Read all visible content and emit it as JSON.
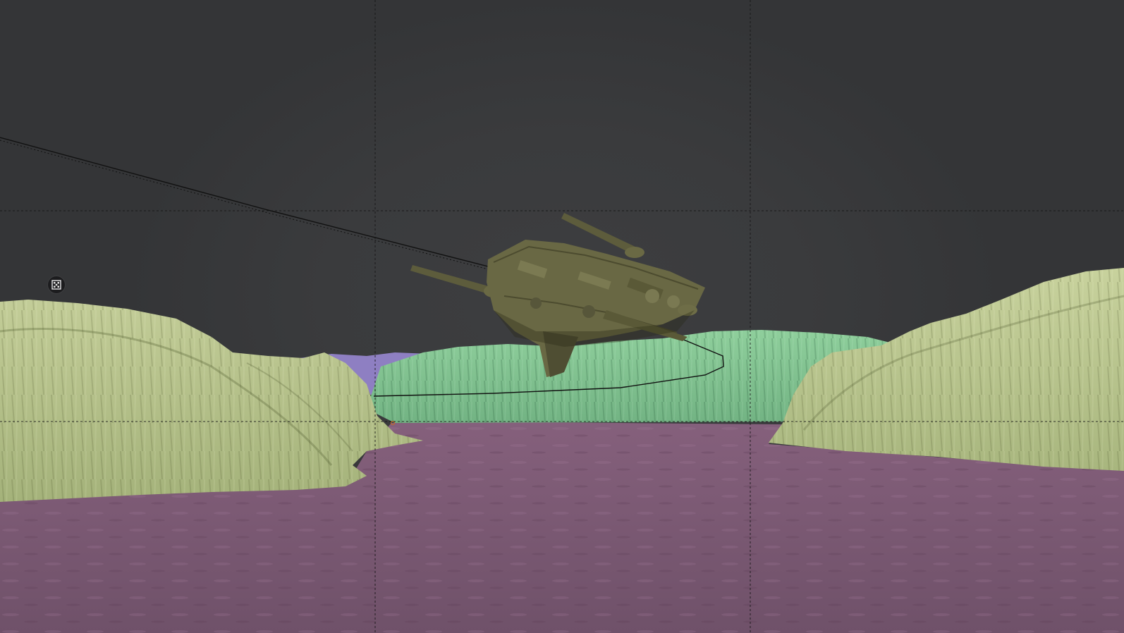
{
  "app": {
    "name": "3D viewport",
    "mode": "camera-view"
  },
  "viewport": {
    "background_color": "#3a3b3d",
    "composition_guide": "rule-of-thirds",
    "guide_color": "#141414"
  },
  "scene": {
    "objects": [
      {
        "name": "spaceship",
        "color": "#6b6a44"
      },
      {
        "name": "cliffs-left",
        "color": "#b9c58f"
      },
      {
        "name": "cliffs-right",
        "color": "#bcc994"
      },
      {
        "name": "ridge-back",
        "color": "#86c495"
      },
      {
        "name": "distant-hill",
        "color": "#8e7fc2"
      },
      {
        "name": "ground-plane",
        "color": "#7a5873"
      }
    ],
    "motion_path_color": "#111111"
  },
  "icons": {
    "camera_gizmo": "film-clapper-icon"
  }
}
